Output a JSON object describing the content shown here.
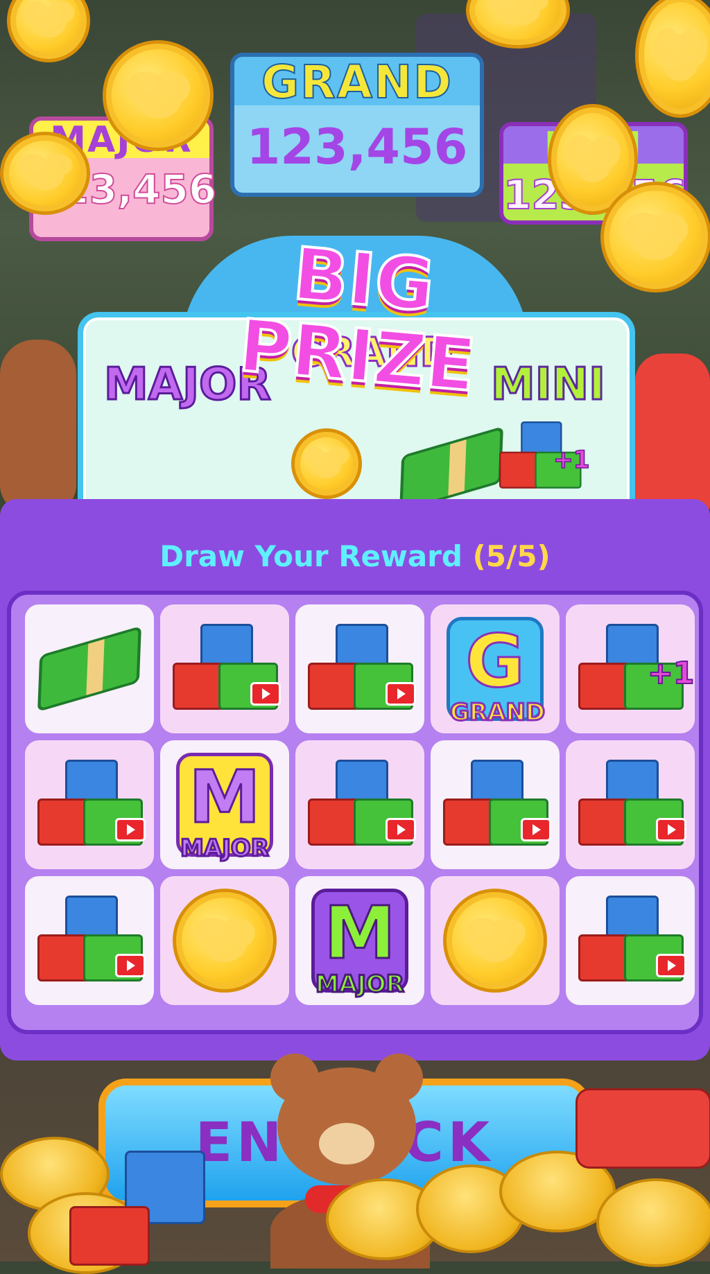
{
  "jackpots": {
    "major": {
      "label": "MAJOR",
      "value": "123,456"
    },
    "grand": {
      "label": "GRAND",
      "value": "123,456"
    },
    "mini": {
      "label": "MINI",
      "value": "123,456"
    }
  },
  "big_prize": {
    "title": "BIG PRIZE",
    "grand_label": "GRAND",
    "major_label": "MAJOR",
    "mini_label": "MINI",
    "icons": [
      "coin-icon",
      "cash-stack-icon",
      "blocks-plus-one-icon"
    ],
    "plus_one": "+1"
  },
  "draw": {
    "title": "Draw Your Reward",
    "count": "(5/5)"
  },
  "grid": {
    "tiles": [
      {
        "type": "cash",
        "icon": "cash-stack-icon"
      },
      {
        "type": "blocks-ad",
        "icon": "blocks-video-icon"
      },
      {
        "type": "blocks-ad",
        "icon": "blocks-video-icon"
      },
      {
        "type": "grand",
        "letter": "G",
        "label": "GRAND"
      },
      {
        "type": "blocks-plus",
        "icon": "blocks-plus-one-icon",
        "plus": "+1"
      },
      {
        "type": "blocks-ad",
        "icon": "blocks-video-icon"
      },
      {
        "type": "major-y",
        "letter": "M",
        "label": "MAJOR"
      },
      {
        "type": "blocks-ad",
        "icon": "blocks-video-icon"
      },
      {
        "type": "blocks-ad",
        "icon": "blocks-video-icon"
      },
      {
        "type": "blocks-ad",
        "icon": "blocks-video-icon"
      },
      {
        "type": "blocks-ad",
        "icon": "blocks-video-icon"
      },
      {
        "type": "coin",
        "icon": "coin-icon"
      },
      {
        "type": "major-p",
        "letter": "M",
        "label": "MAJOR"
      },
      {
        "type": "coin",
        "icon": "coin-icon"
      },
      {
        "type": "blocks-ad",
        "icon": "blocks-video-icon"
      }
    ]
  },
  "end_button": {
    "label": "END    ACK"
  },
  "colors": {
    "accent_purple": "#8d4ce0",
    "draw_title_cyan": "#5ff0ff",
    "count_yellow": "#ffd84a",
    "button_blue": "#1fa2ee",
    "button_border": "#f5a21a"
  }
}
